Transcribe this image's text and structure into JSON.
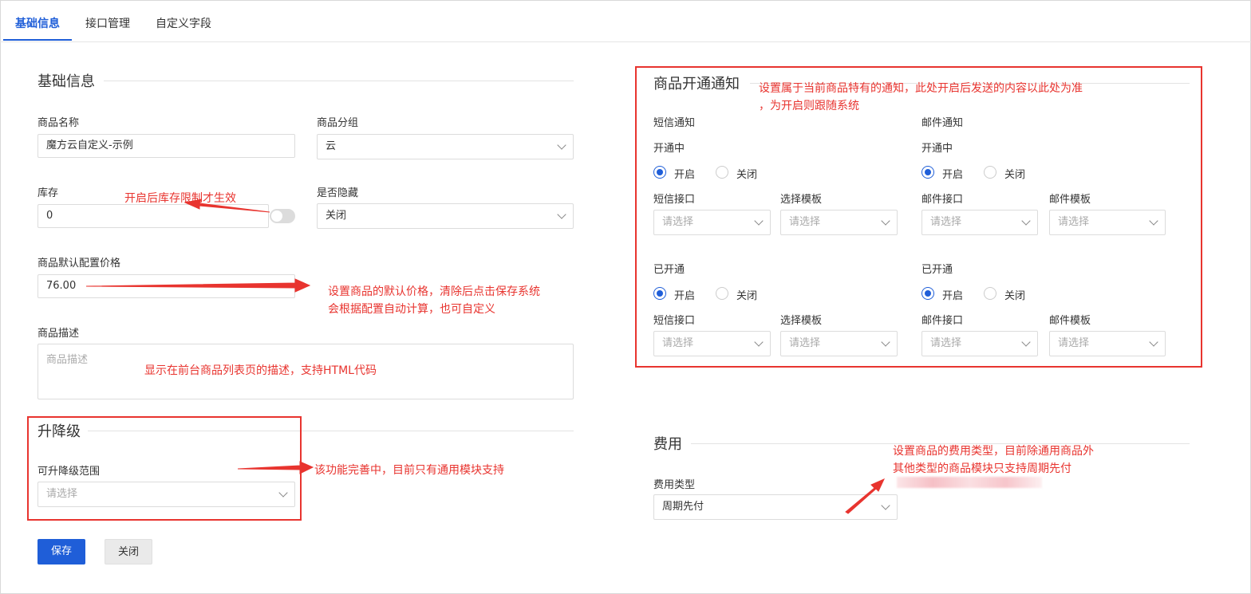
{
  "tabs": [
    {
      "label": "基础信息",
      "active": true
    },
    {
      "label": "接口管理",
      "active": false
    },
    {
      "label": "自定义字段",
      "active": false
    }
  ],
  "basic": {
    "title": "基础信息",
    "name_label": "商品名称",
    "name_value": "魔方云自定义-示例",
    "group_label": "商品分组",
    "group_value": "云",
    "stock_label": "库存",
    "stock_value": "0",
    "stock_toggle_on": false,
    "hidden_label": "是否隐藏",
    "hidden_value": "关闭",
    "price_label": "商品默认配置价格",
    "price_value": "76.00",
    "desc_label": "商品描述",
    "desc_placeholder": "商品描述"
  },
  "upgrade": {
    "title": "升降级",
    "range_label": "可升降级范围",
    "range_placeholder": "请选择"
  },
  "notify": {
    "title": "商品开通通知",
    "sms_title": "短信通知",
    "email_title": "邮件通知",
    "activating": "开通中",
    "activated": "已开通",
    "radio_on": "开启",
    "radio_off": "关闭",
    "sms_api": "短信接口",
    "sms_tpl": "选择模板",
    "email_api": "邮件接口",
    "email_tpl": "邮件模板",
    "placeholder": "请选择"
  },
  "fee": {
    "title": "费用",
    "type_label": "费用类型",
    "type_value": "周期先付"
  },
  "buttons": {
    "save": "保存",
    "close": "关闭"
  },
  "annotations": {
    "stock": "开启后库存限制才生效",
    "price_line1": "设置商品的默认价格，清除后点击保存系统",
    "price_line2": "会根据配置自动计算，也可自定义",
    "desc": "显示在前台商品列表页的描述，支持HTML代码",
    "upgrade": "该功能完善中，目前只有通用模块支持",
    "notify_line1": "设置属于当前商品特有的通知，此处开启后发送的内容以此处为准",
    "notify_line2": "，为开启则跟随系统",
    "fee_line1": "设置商品的费用类型，目前除通用商品外",
    "fee_line2": "其他类型的商品模块只支持周期先付"
  },
  "colors": {
    "accent": "#1f5ed8",
    "annotation": "#e8342f"
  }
}
